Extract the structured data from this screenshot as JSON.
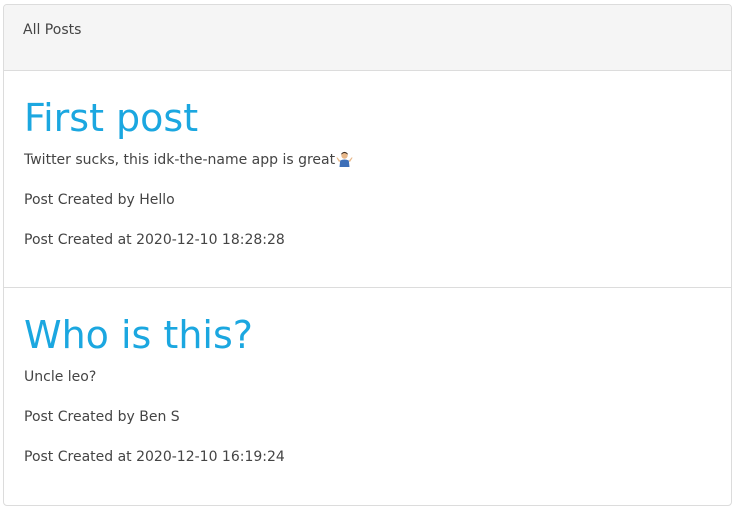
{
  "panel": {
    "heading": "All Posts"
  },
  "posts": [
    {
      "title": "First post",
      "body": "Twitter sucks, this idk-the-name app is great",
      "body_icon": "person-shrugging-icon",
      "author_line": "Post Created by Hello",
      "date_line": "Post Created at 2020-12-10 18:28:28"
    },
    {
      "title": "Who is this?",
      "body": "Uncle leo?",
      "author_line": "Post Created by Ben S",
      "date_line": "Post Created at 2020-12-10 16:19:24"
    }
  ],
  "colors": {
    "title": "#1ba7e0",
    "heading_bg": "#f5f5f5",
    "border": "#dcdcdc"
  }
}
